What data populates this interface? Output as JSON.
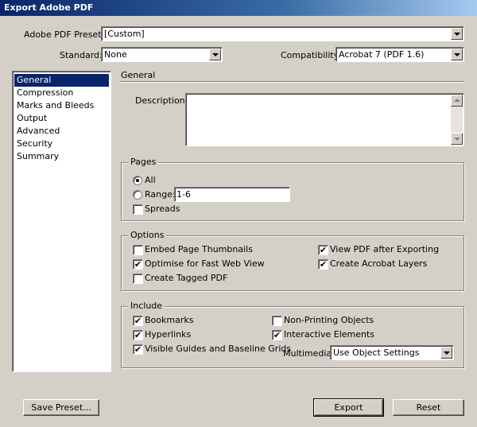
{
  "window": {
    "title": "Export Adobe PDF"
  },
  "header": {
    "preset_label": "Adobe PDF Preset:",
    "preset_value": "[Custom]",
    "standard_label": "Standard:",
    "standard_value": "None",
    "compat_label": "Compatibility:",
    "compat_value": "Acrobat 7 (PDF 1.6)"
  },
  "sidebar": {
    "items": [
      "General",
      "Compression",
      "Marks and Bleeds",
      "Output",
      "Advanced",
      "Security",
      "Summary"
    ],
    "selected": "General"
  },
  "general": {
    "section_title": "General",
    "description_label": "Description:",
    "description_value": ""
  },
  "pages": {
    "title": "Pages",
    "all_label": "All",
    "range_label": "Range:",
    "range_value": "1-6",
    "spreads_label": "Spreads"
  },
  "options": {
    "title": "Options",
    "embed_thumbnails": "Embed Page Thumbnails",
    "optimise_web": "Optimise for Fast Web View",
    "create_tagged": "Create Tagged PDF",
    "view_after": "View PDF after Exporting",
    "acrobat_layers": "Create Acrobat Layers"
  },
  "include": {
    "title": "Include",
    "bookmarks": "Bookmarks",
    "hyperlinks": "Hyperlinks",
    "guides": "Visible Guides and Baseline Grids",
    "non_printing": "Non-Printing Objects",
    "interactive": "Interactive Elements",
    "multimedia_label": "Multimedia:",
    "multimedia_value": "Use Object Settings"
  },
  "buttons": {
    "save_preset": "Save Preset...",
    "export": "Export",
    "reset": "Reset"
  },
  "checkbox_mark": "✔",
  "colors": {
    "selection": "#0a246a",
    "dialog_bg": "#d4d0c8"
  }
}
